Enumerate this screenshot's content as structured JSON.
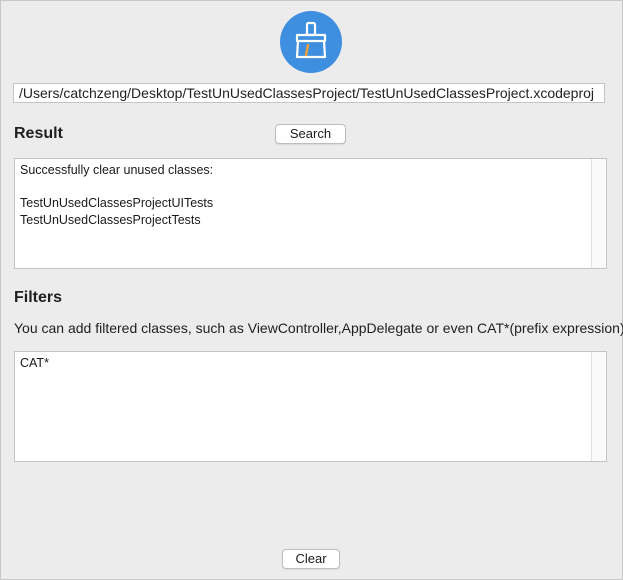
{
  "app": {
    "icon": "broom-icon",
    "accent_color": "#3f8fe0"
  },
  "path_field": {
    "value": "/Users/catchzeng/Desktop/TestUnUsedClassesProject/TestUnUsedClassesProject.xcodeproj"
  },
  "result": {
    "title": "Result",
    "search_label": "Search",
    "output_lines": [
      "Successfully clear unused classes:",
      "",
      "TestUnUsedClassesProjectUITests",
      "TestUnUsedClassesProjectTests"
    ]
  },
  "filters": {
    "title": "Filters",
    "hint": "You can add filtered classes, such as ViewController,AppDelegate or even CAT*(prefix expression)",
    "value": "CAT*"
  },
  "footer": {
    "clear_label": "Clear"
  }
}
